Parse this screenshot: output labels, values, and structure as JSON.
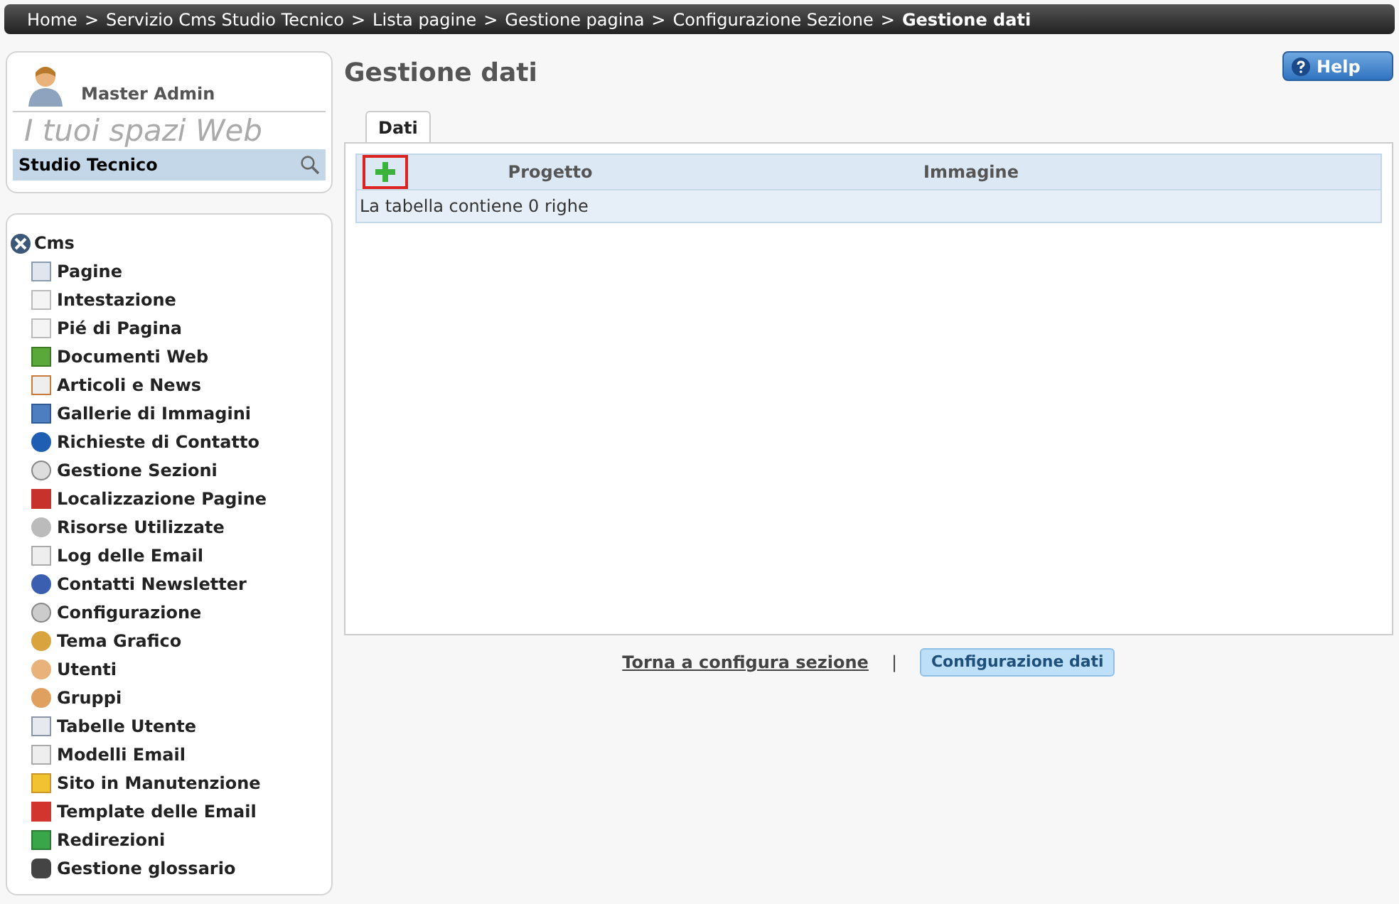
{
  "breadcrumb": [
    {
      "label": "Home",
      "current": false
    },
    {
      "label": "Servizio Cms Studio Tecnico",
      "current": false
    },
    {
      "label": "Lista pagine",
      "current": false
    },
    {
      "label": "Gestione pagina",
      "current": false
    },
    {
      "label": "Configurazione Sezione",
      "current": false
    },
    {
      "label": "Gestione dati",
      "current": true
    }
  ],
  "breadcrumb_separator": ">",
  "user": {
    "name": "Master Admin",
    "tagline": "I tuoi spazi Web",
    "site": "Studio Tecnico"
  },
  "menu": {
    "title": "Cms",
    "items": [
      "Pagine",
      "Intestazione",
      "Pié di Pagina",
      "Documenti Web",
      "Articoli e News",
      "Gallerie di Immagini",
      "Richieste di Contatto",
      "Gestione Sezioni",
      "Localizzazione Pagine",
      "Risorse Utilizzate",
      "Log delle Email",
      "Contatti Newsletter",
      "Configurazione",
      "Tema Grafico",
      "Utenti",
      "Gruppi",
      "Tabelle Utente",
      "Modelli Email",
      "Sito in Manutenzione",
      "Template delle Email",
      "Redirezioni",
      "Gestione glossario"
    ]
  },
  "page_title": "Gestione dati",
  "help_button": "Help",
  "tabs": [
    {
      "label": "Dati",
      "selected": true
    }
  ],
  "table": {
    "columns": [
      "Progetto",
      "Immagine"
    ],
    "summary": "La tabella contiene 0 righe"
  },
  "footer": {
    "back_link": "Torna a configura sezione",
    "separator": "|",
    "config_button": "Configurazione dati"
  }
}
